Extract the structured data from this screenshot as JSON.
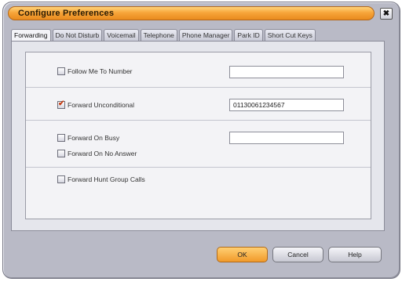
{
  "window": {
    "title": "Configure Preferences",
    "close_label": "✖"
  },
  "tabs": [
    {
      "label": "Forwarding",
      "active": true
    },
    {
      "label": "Do Not Disturb"
    },
    {
      "label": "Voicemail"
    },
    {
      "label": "Telephone"
    },
    {
      "label": "Phone Manager"
    },
    {
      "label": "Park ID"
    },
    {
      "label": "Short Cut Keys"
    }
  ],
  "forwarding": {
    "follow_me": {
      "label": "Follow Me To Number",
      "checked": false,
      "value": ""
    },
    "unconditional": {
      "label": "Forward Unconditional",
      "checked": true,
      "value": "01130061234567"
    },
    "on_busy": {
      "label": "Forward On Busy",
      "checked": false,
      "value": ""
    },
    "on_no_answer": {
      "label": "Forward On No Answer",
      "checked": false
    },
    "hunt_group": {
      "label": "Forward Hunt Group Calls",
      "checked": false
    }
  },
  "buttons": {
    "ok": "OK",
    "cancel": "Cancel",
    "help": "Help"
  },
  "colors": {
    "accent": "#f19a2a",
    "check": "#c23b14",
    "background": "#b9bac6"
  }
}
